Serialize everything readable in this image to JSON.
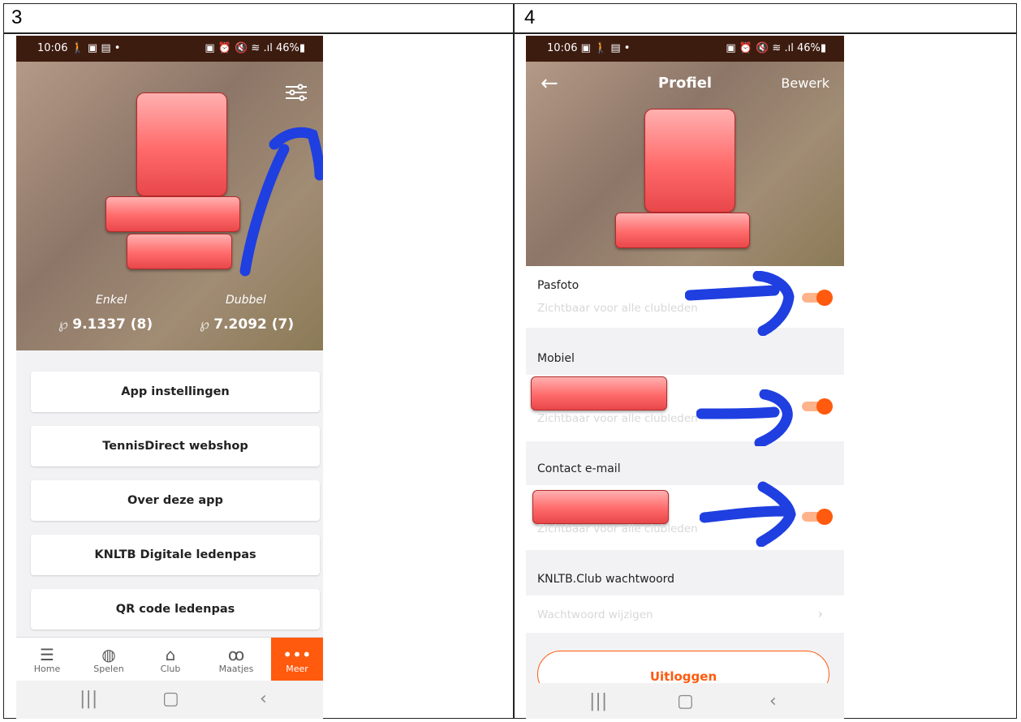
{
  "cells": [
    "3",
    "4"
  ],
  "status": {
    "time": "10:06",
    "left_icons_a": "🚶 ▣ ▤ •",
    "left_icons_b": "▣ 🚶 ▤ •",
    "right": "▣ ⏰ 🔇 ≋ .ıl 46%▮"
  },
  "screen3": {
    "ratings": {
      "singles_label": "Enkel",
      "singles_value": "9.1337 (8)",
      "doubles_label": "Dubbel",
      "doubles_value": "7.2092 (7)"
    },
    "menu": [
      "App instellingen",
      "TennisDirect webshop",
      "Over deze app",
      "KNLTB Digitale ledenpas",
      "QR code ledenpas"
    ],
    "tabs": [
      {
        "label": "Home",
        "icon": "☰"
      },
      {
        "label": "Spelen",
        "icon": "◍"
      },
      {
        "label": "Club",
        "icon": "⌂"
      },
      {
        "label": "Maatjes",
        "icon": "ꝏ"
      },
      {
        "label": "Meer",
        "icon": "•••"
      }
    ]
  },
  "screen4": {
    "title": "Profiel",
    "edit": "Bewerk",
    "photo_label": "Pasfoto",
    "photo_sub": "Zichtbaar voor alle clubleden",
    "mobile_label": "Mobiel",
    "mobile_sub": "Zichtbaar voor alle clubleden",
    "email_label": "Contact e-mail",
    "email_sub": "Zichtbaar voor alle clubleden",
    "password_label": "KNLTB.Club wachtwoord",
    "password_link": "Wachtwoord wijzigen",
    "logout": "Uitloggen"
  },
  "nav": {
    "recents": "|||",
    "home": "▢",
    "back": "‹"
  },
  "colors": {
    "accent": "#ff5a0e",
    "annotation": "#1f3fe0",
    "status_bg": "#3d1c10"
  }
}
